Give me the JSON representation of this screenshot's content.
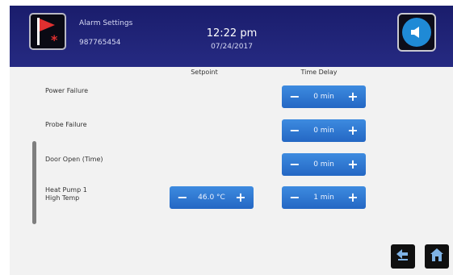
{
  "header": {
    "title": "Alarm Settings",
    "device_id": "987765454",
    "time": "12:22 pm",
    "date": "07/24/2017"
  },
  "columns": {
    "setpoint": "Setpoint",
    "time_delay": "Time Delay"
  },
  "rows": [
    {
      "label": "Power Failure",
      "delay": "0 min"
    },
    {
      "label": "Probe Failure",
      "delay": "0 min"
    },
    {
      "label": "Door Open (Time)",
      "delay": "0 min"
    },
    {
      "label_line1": "Heat Pump 1",
      "label_line2": "High Temp",
      "setpoint": "46.0 °C",
      "delay": "1 min"
    }
  ],
  "icons": {
    "alarm": "alarm-flag-icon",
    "audio": "speaker-icon",
    "back": "back-arrow-icon",
    "home": "home-icon",
    "minus": "minus-icon",
    "plus": "plus-icon"
  },
  "colors": {
    "header": "#1f2276",
    "stepper": "#2f78d8",
    "accent_red": "#e03030"
  }
}
